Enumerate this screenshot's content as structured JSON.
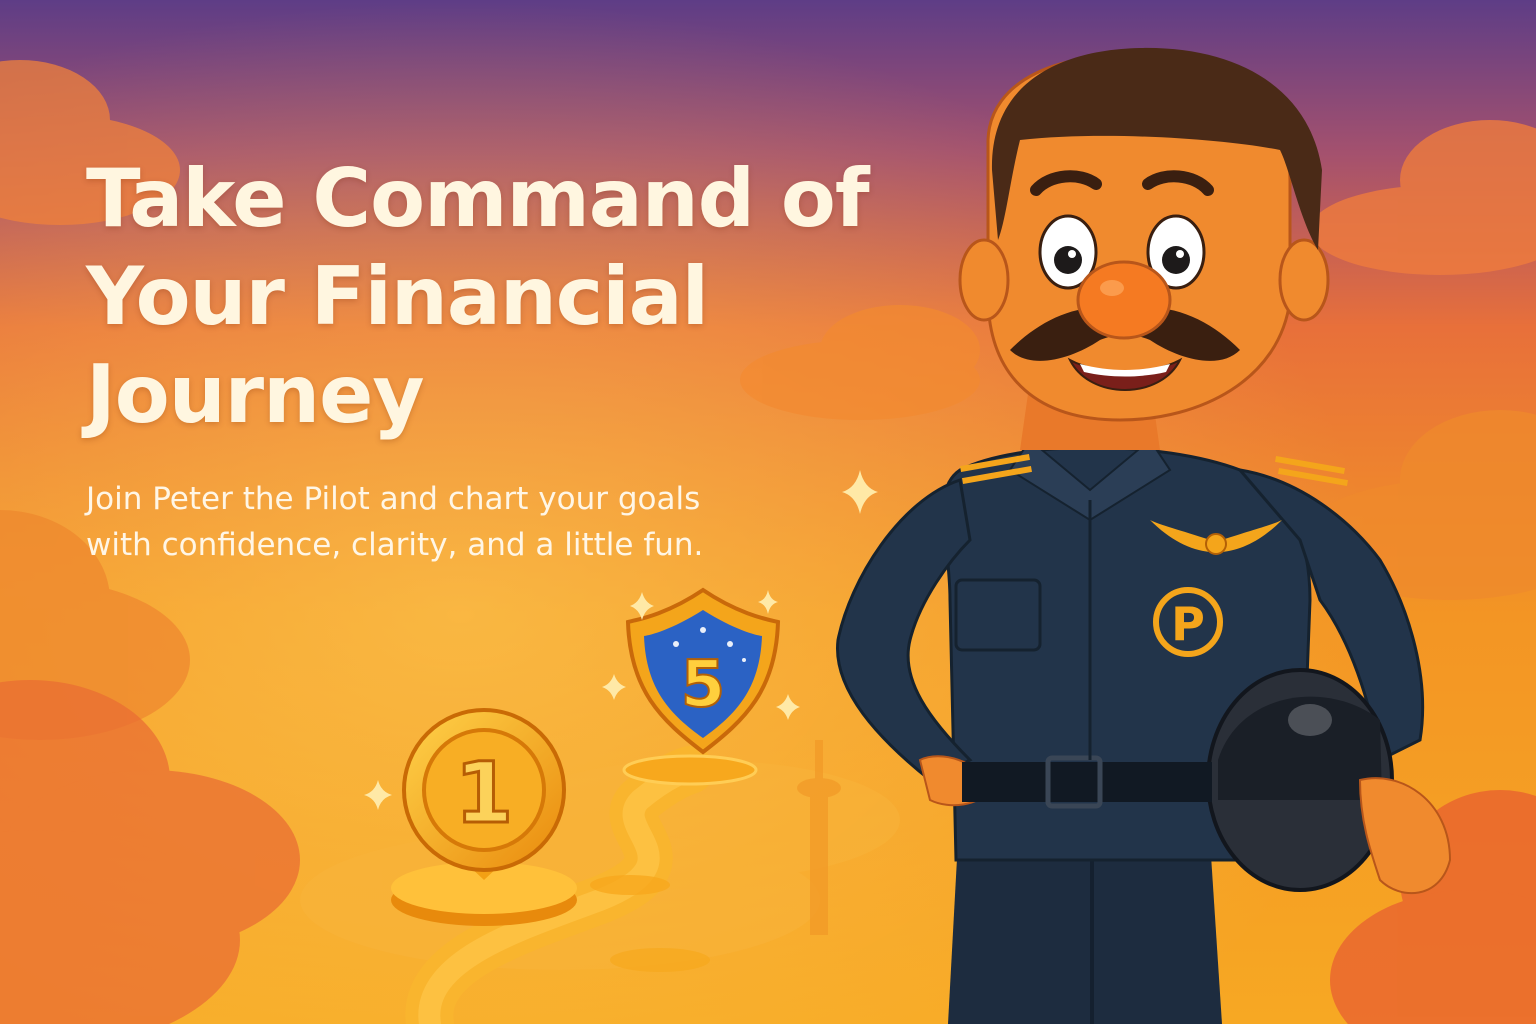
{
  "hero": {
    "headline_lines": [
      "Take Command of",
      "Your Financial",
      "Journey"
    ],
    "subtitle_lines": [
      "Join Peter the Pilot and chart your goals",
      "with confidence, clarity, and a little fun."
    ]
  },
  "badges": {
    "coin_number": "1",
    "shield_number": "5",
    "chest_emblem_letter": "P"
  },
  "colors": {
    "sky_top": "#5e3d86",
    "sky_mid": "#e8703a",
    "sky_bottom": "#f7a823",
    "uniform": "#22344a",
    "gold": "#f6a516",
    "headline_text": "#fff6e0"
  },
  "icons": [
    "sparkle-icon",
    "coin-marker-icon",
    "shield-badge-icon",
    "pilot-wings-icon",
    "helmet-icon"
  ]
}
